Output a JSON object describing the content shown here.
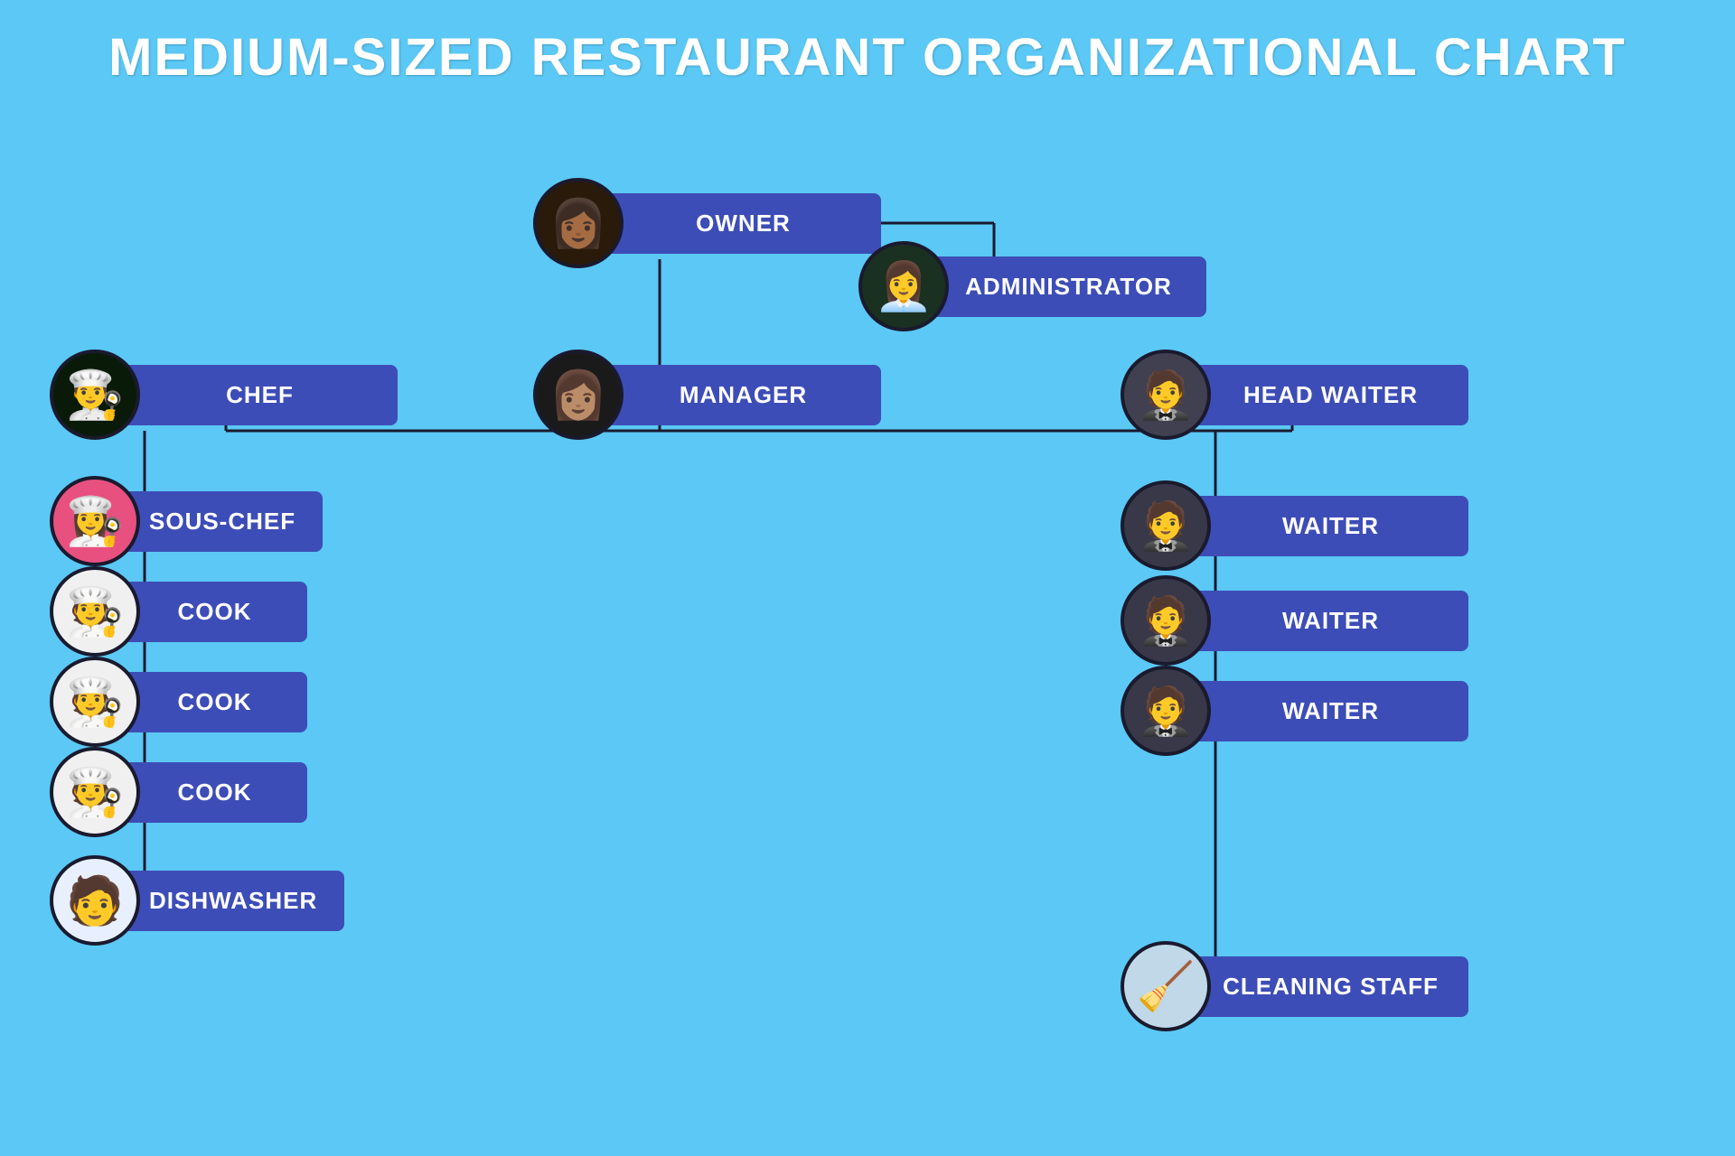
{
  "title": "MEDIUM-SIZED RESTAURANT ORGANIZATIONAL CHART",
  "colors": {
    "background": "#5bc8f5",
    "nodeBg": "#3d4db7",
    "connectorLine": "#1a1a2e",
    "nodeText": "#ffffff"
  },
  "nodes": {
    "owner": {
      "label": "OWNER"
    },
    "administrator": {
      "label": "ADMINISTRATOR"
    },
    "manager": {
      "label": "MANAGER"
    },
    "chef": {
      "label": "CHEF"
    },
    "souschef": {
      "label": "SOUS-CHEF"
    },
    "cook1": {
      "label": "COOK"
    },
    "cook2": {
      "label": "COOK"
    },
    "cook3": {
      "label": "COOK"
    },
    "dishwasher": {
      "label": "DISHWASHER"
    },
    "headwaiter": {
      "label": "HEAD WAITER"
    },
    "waiter1": {
      "label": "WAITER"
    },
    "waiter2": {
      "label": "WAITER"
    },
    "waiter3": {
      "label": "WAITER"
    },
    "cleaningstaff": {
      "label": "CLEANING STAFF"
    }
  }
}
